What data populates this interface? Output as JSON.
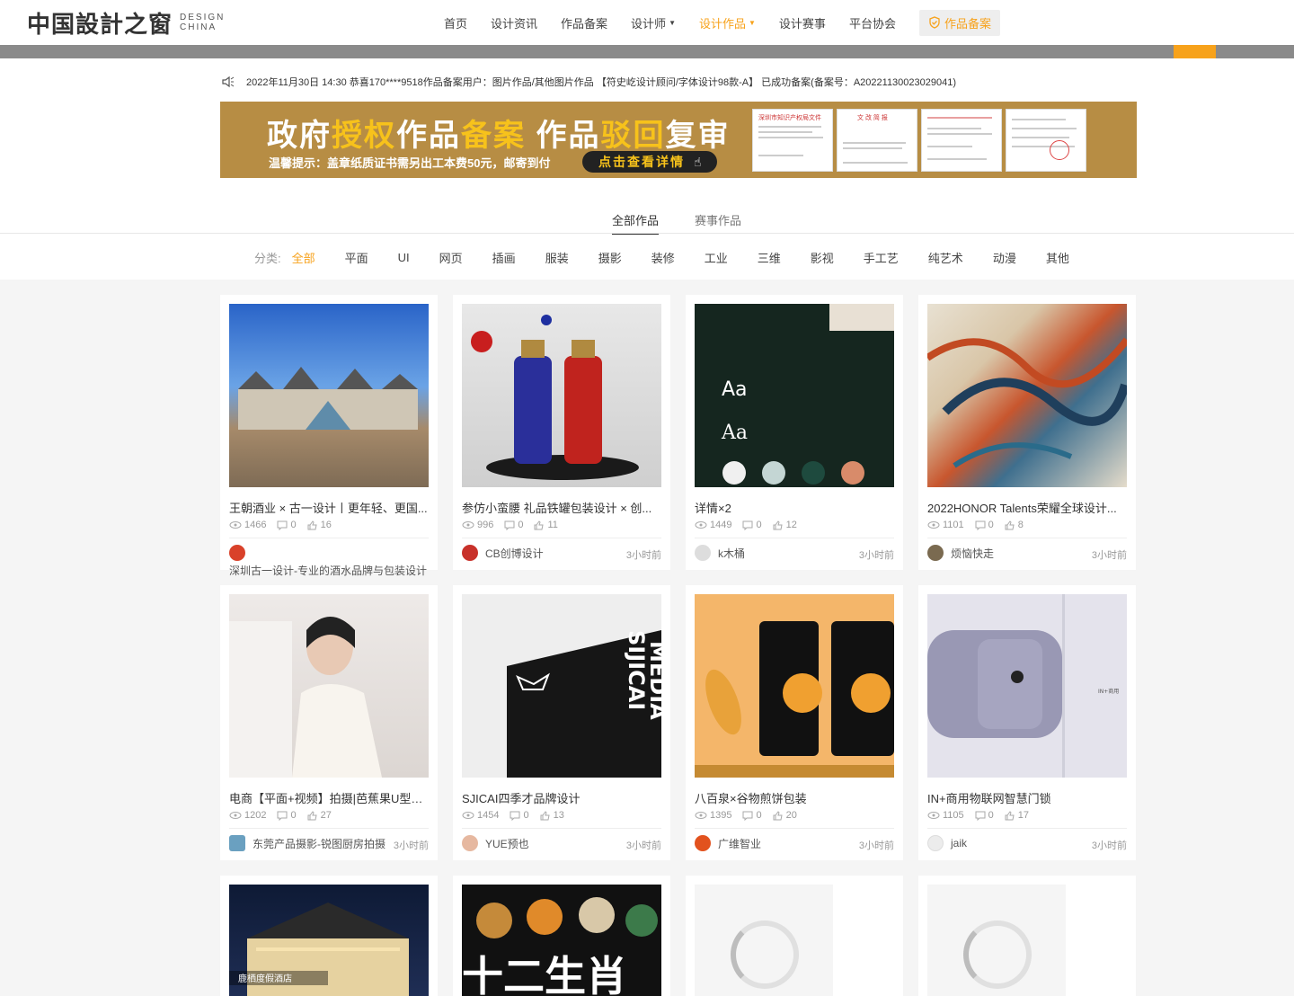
{
  "header": {
    "logo_cn": "中国設計之窗",
    "logo_en_1": "DESIGN",
    "logo_en_2": "CHINA",
    "nav": [
      {
        "label": "首页"
      },
      {
        "label": "设计资讯"
      },
      {
        "label": "作品备案"
      },
      {
        "label": "设计师"
      },
      {
        "label": "设计作品"
      },
      {
        "label": "设计赛事"
      },
      {
        "label": "平台协会"
      }
    ],
    "nav_badge": "作品备案"
  },
  "notice": "2022年11月30日 14:30  恭喜170****9518作品备案用户：图片作品/其他图片作品 【符史屹设计顾问/字体设计98款-A】 已成功备案(备案号：A20221130023029041)",
  "banner": {
    "title_a": "政府",
    "title_b": "授权",
    "title_c": "作品",
    "title_d": "备案",
    "title_e": "作品",
    "title_f": "驳回",
    "title_g": "复审",
    "tip": "温馨提示：盖章纸质证书需另出工本费50元，邮寄到付",
    "button": "点击查看详情",
    "doc1": "深圳市知识产权局文件",
    "doc2": "文 改 简 报"
  },
  "tabs": [
    {
      "label": "全部作品"
    },
    {
      "label": "赛事作品"
    }
  ],
  "categories": {
    "label": "分类:",
    "items": [
      "全部",
      "平面",
      "UI",
      "网页",
      "插画",
      "服装",
      "摄影",
      "装修",
      "工业",
      "三维",
      "影视",
      "手工艺",
      "纯艺术",
      "动漫",
      "其他"
    ]
  },
  "cards": [
    {
      "title": "王朝酒业 × 古一设计丨更年轻、更国...",
      "views": "1466",
      "comments": "0",
      "likes": "16",
      "author": "深圳古一设计-专业的酒水品牌与包装设计",
      "time": ""
    },
    {
      "title": "参仿小蛮腰 礼品铁罐包装设计 × 创...",
      "views": "996",
      "comments": "0",
      "likes": "11",
      "author": "CB创博设计",
      "time": "3小时前"
    },
    {
      "title": "详情×2",
      "views": "1449",
      "comments": "0",
      "likes": "12",
      "author": "k木桶",
      "time": "3小时前"
    },
    {
      "title": "2022HONOR Talents荣耀全球设计...",
      "views": "1101",
      "comments": "0",
      "likes": "8",
      "author": "烦恼快走",
      "time": "3小时前"
    },
    {
      "title": "电商【平面+视频】拍摄|芭蕉果U型枕...",
      "views": "1202",
      "comments": "0",
      "likes": "27",
      "author": "东莞产品摄影-锐图厨房拍摄",
      "time": "3小时前"
    },
    {
      "title": "SJICAI四季才品牌设计",
      "views": "1454",
      "comments": "0",
      "likes": "13",
      "author": "YUE预也",
      "time": "3小时前"
    },
    {
      "title": "八百泉×谷物煎饼包装",
      "views": "1395",
      "comments": "0",
      "likes": "20",
      "author": "广维智业",
      "time": "3小时前"
    },
    {
      "title": "IN+商用物联网智慧门锁",
      "views": "1105",
      "comments": "0",
      "likes": "17",
      "author": "jaik",
      "time": "3小时前"
    }
  ],
  "thumb_text": {
    "aa": "Aa",
    "sjicai": "SIJICAI",
    "media": "MEDIA",
    "hotel": "鹿栖度假酒店",
    "zodiac": "十二生肖",
    "in_plus": "IN+商用"
  },
  "colors": {
    "accent": "#f7a21b",
    "banner": "#b78d44"
  }
}
